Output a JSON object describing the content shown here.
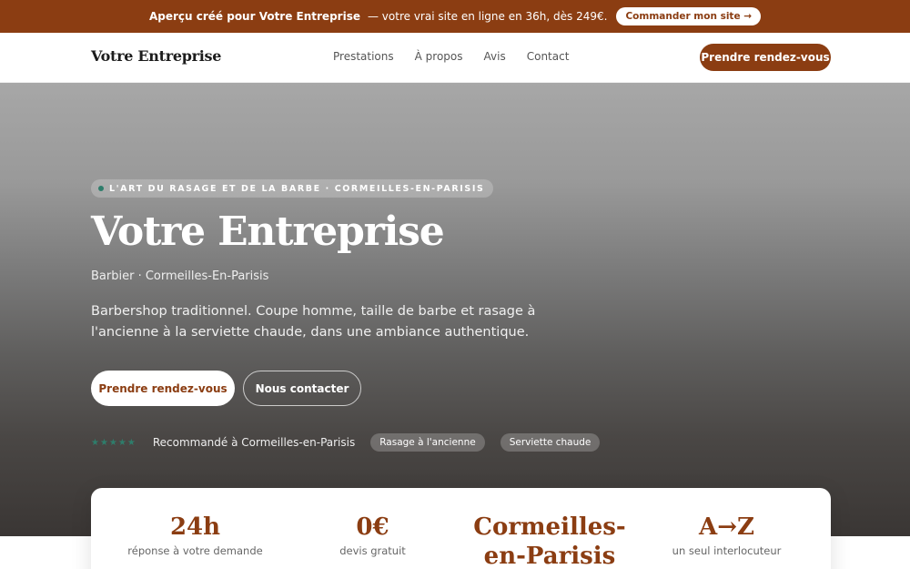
{
  "promo": {
    "strong": "Aperçu créé pour Votre Entreprise",
    "text": "— votre vrai site en ligne en 36h, dès 249€.",
    "cta": "Commander mon site →"
  },
  "nav": {
    "brand": "Votre Entreprise",
    "links": [
      "Prestations",
      "À propos",
      "Avis",
      "Contact"
    ],
    "cta": "Prendre rendez-vous"
  },
  "hero": {
    "kicker": "L'ART DU RASAGE ET DE LA BARBE · CORMEILLES-EN-PARISIS",
    "title": "Votre Entreprise",
    "subtitle": "Barbier · Cormeilles-En-Parisis",
    "description": "Barbershop traditionnel. Coupe homme, taille de barbe et rasage à l'ancienne à la serviette chaude, dans une ambiance authentique.",
    "primary_cta": "Prendre rendez-vous",
    "secondary_cta": "Nous contacter",
    "stars": "★★★★★",
    "trust_text": "Recommandé à Cormeilles-en-Parisis",
    "tags": [
      "Rasage à l'ancienne",
      "Serviette chaude"
    ]
  },
  "stats": [
    {
      "value": "24h",
      "label": "réponse à votre demande"
    },
    {
      "value": "0€",
      "label": "devis gratuit"
    },
    {
      "value": "Cormeilles-en-Parisis",
      "label": ""
    },
    {
      "value": "A→Z",
      "label": "un seul interlocuteur"
    }
  ],
  "colors": {
    "brand": "#8b3d12",
    "accent_dot": "#2e7d6b"
  }
}
